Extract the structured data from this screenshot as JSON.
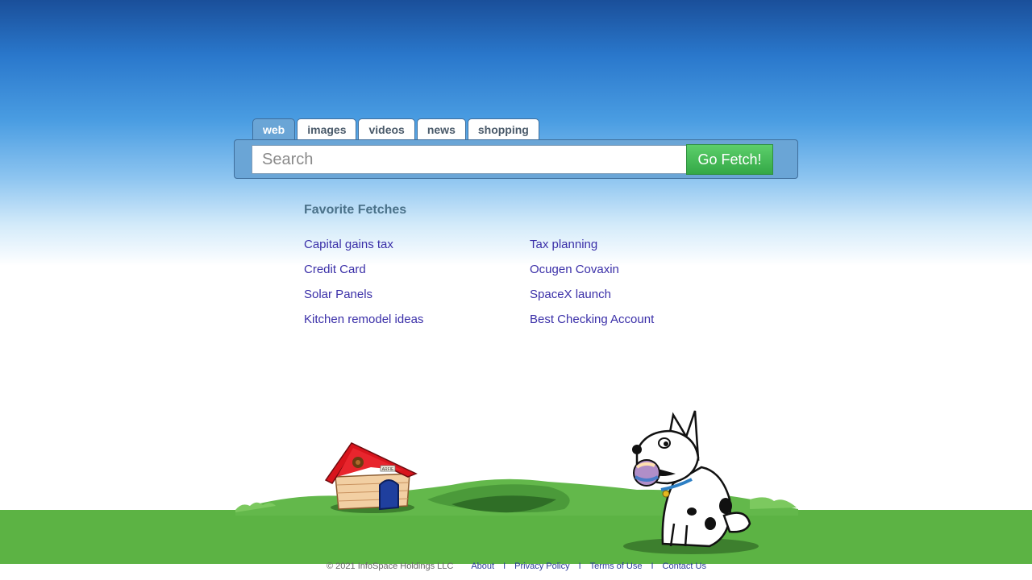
{
  "tabs": [
    {
      "label": "web",
      "active": true
    },
    {
      "label": "images",
      "active": false
    },
    {
      "label": "videos",
      "active": false
    },
    {
      "label": "news",
      "active": false
    },
    {
      "label": "shopping",
      "active": false
    }
  ],
  "search": {
    "placeholder": "Search",
    "value": "",
    "button_label": "Go Fetch!"
  },
  "favorites": {
    "title": "Favorite Fetches",
    "links": [
      "Capital gains tax",
      "Tax planning",
      "Credit Card",
      "Ocugen Covaxin",
      "Solar Panels",
      "SpaceX launch",
      "Kitchen remodel ideas",
      "Best Checking Account"
    ]
  },
  "scene": {
    "doghouse_sign": "ARFIE"
  },
  "footer": {
    "copyright": "© 2021 InfoSpace Holdings LLC",
    "links": [
      "About",
      "Privacy Policy",
      "Terms of Use",
      "Contact Us"
    ],
    "separator": "I"
  },
  "colors": {
    "accent_blue": "#6aa5d6",
    "button_green": "#34a847",
    "link": "#3a2fa8",
    "grass": "#5cb344",
    "roof_red": "#d8141c"
  }
}
